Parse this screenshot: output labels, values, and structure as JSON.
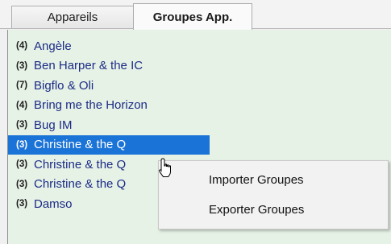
{
  "tabs": [
    {
      "label": "Appareils"
    },
    {
      "label": "Groupes App."
    }
  ],
  "groups": [
    {
      "count": "(4)",
      "name": "Angèle"
    },
    {
      "count": "(3)",
      "name": "Ben Harper & the IC"
    },
    {
      "count": "(7)",
      "name": "Bigflo & Oli"
    },
    {
      "count": "(4)",
      "name": "Bring me the Horizon"
    },
    {
      "count": "(3)",
      "name": "Bug IM"
    },
    {
      "count": "(3)",
      "name": "Christine & the Q"
    },
    {
      "count": "(3)",
      "name": "Christine & the Q"
    },
    {
      "count": "(3)",
      "name": "Christine & the Q"
    },
    {
      "count": "(3)",
      "name": "Damso"
    }
  ],
  "context_menu": {
    "items": [
      {
        "label": "Importer Groupes"
      },
      {
        "label": "Exporter Groupes"
      }
    ]
  },
  "colors": {
    "list_background": "#e6f2e6",
    "selection": "#1a73d6",
    "name_text": "#1c2b86"
  },
  "icons": {
    "cursor": "hand-pointer-icon"
  }
}
